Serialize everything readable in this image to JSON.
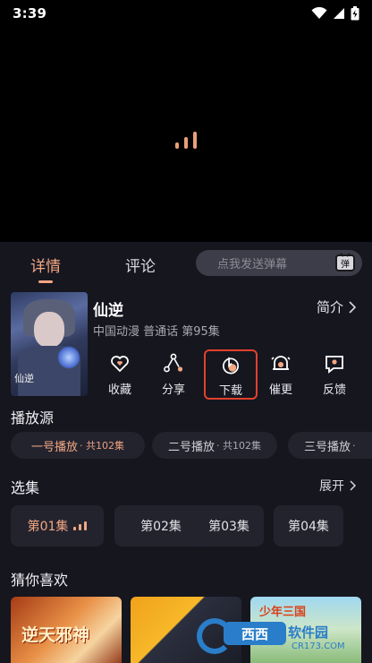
{
  "status_bar": {
    "time": "3:39"
  },
  "tabs": {
    "detail": "详情",
    "comment": "评论"
  },
  "danmaku": {
    "placeholder": "点我发送弹幕",
    "icon": "danmaku-icon",
    "icon_text": "弹"
  },
  "show": {
    "title": "仙逆",
    "meta": "中国动漫 普通话 第95集",
    "intro_label": "简介",
    "cover_logo": "仙逆"
  },
  "actions": [
    {
      "label": "收藏",
      "icon": "heart-icon"
    },
    {
      "label": "分享",
      "icon": "share-icon"
    },
    {
      "label": "下载",
      "icon": "download-icon"
    },
    {
      "label": "催更",
      "icon": "bell-icon"
    },
    {
      "label": "反馈",
      "icon": "feedback-icon"
    }
  ],
  "sources": {
    "title": "播放源",
    "items": [
      {
        "name": "一号播放",
        "count": "· 共102集"
      },
      {
        "name": "二号播放",
        "count": "· 共102集"
      },
      {
        "name": "三号播放",
        "count": "·"
      }
    ]
  },
  "episodes": {
    "title": "选集",
    "expand_label": "展开",
    "items": [
      "第01集",
      "第02集",
      "第03集",
      "第04集"
    ]
  },
  "recommend": {
    "title": "猜你喜欢",
    "items": [
      "逆天邪神",
      "",
      "少年三国"
    ]
  },
  "watermark": {
    "badge": "西西",
    "title": "软件园",
    "url": "CR173.COM"
  },
  "colors": {
    "accent": "#f2a783",
    "panel": "#16161f",
    "highlight_border": "#e2412d"
  }
}
